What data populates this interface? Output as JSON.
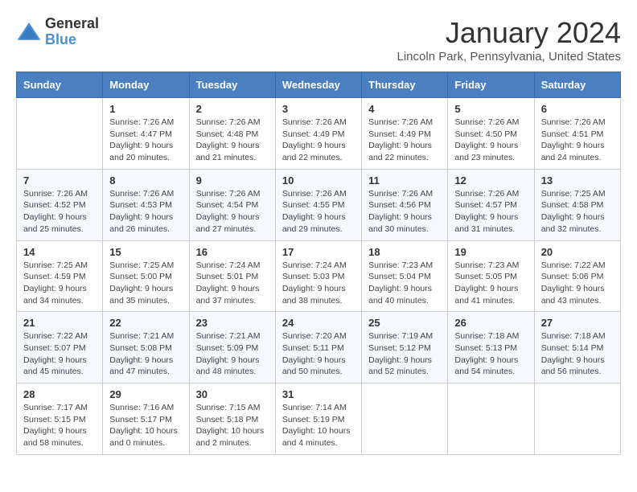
{
  "logo": {
    "general": "General",
    "blue": "Blue"
  },
  "title": "January 2024",
  "location": "Lincoln Park, Pennsylvania, United States",
  "weekdays": [
    "Sunday",
    "Monday",
    "Tuesday",
    "Wednesday",
    "Thursday",
    "Friday",
    "Saturday"
  ],
  "weeks": [
    [
      {
        "day": "",
        "content": ""
      },
      {
        "day": "1",
        "content": "Sunrise: 7:26 AM\nSunset: 4:47 PM\nDaylight: 9 hours\nand 20 minutes."
      },
      {
        "day": "2",
        "content": "Sunrise: 7:26 AM\nSunset: 4:48 PM\nDaylight: 9 hours\nand 21 minutes."
      },
      {
        "day": "3",
        "content": "Sunrise: 7:26 AM\nSunset: 4:49 PM\nDaylight: 9 hours\nand 22 minutes."
      },
      {
        "day": "4",
        "content": "Sunrise: 7:26 AM\nSunset: 4:49 PM\nDaylight: 9 hours\nand 22 minutes."
      },
      {
        "day": "5",
        "content": "Sunrise: 7:26 AM\nSunset: 4:50 PM\nDaylight: 9 hours\nand 23 minutes."
      },
      {
        "day": "6",
        "content": "Sunrise: 7:26 AM\nSunset: 4:51 PM\nDaylight: 9 hours\nand 24 minutes."
      }
    ],
    [
      {
        "day": "7",
        "content": "Sunrise: 7:26 AM\nSunset: 4:52 PM\nDaylight: 9 hours\nand 25 minutes."
      },
      {
        "day": "8",
        "content": "Sunrise: 7:26 AM\nSunset: 4:53 PM\nDaylight: 9 hours\nand 26 minutes."
      },
      {
        "day": "9",
        "content": "Sunrise: 7:26 AM\nSunset: 4:54 PM\nDaylight: 9 hours\nand 27 minutes."
      },
      {
        "day": "10",
        "content": "Sunrise: 7:26 AM\nSunset: 4:55 PM\nDaylight: 9 hours\nand 29 minutes."
      },
      {
        "day": "11",
        "content": "Sunrise: 7:26 AM\nSunset: 4:56 PM\nDaylight: 9 hours\nand 30 minutes."
      },
      {
        "day": "12",
        "content": "Sunrise: 7:26 AM\nSunset: 4:57 PM\nDaylight: 9 hours\nand 31 minutes."
      },
      {
        "day": "13",
        "content": "Sunrise: 7:25 AM\nSunset: 4:58 PM\nDaylight: 9 hours\nand 32 minutes."
      }
    ],
    [
      {
        "day": "14",
        "content": "Sunrise: 7:25 AM\nSunset: 4:59 PM\nDaylight: 9 hours\nand 34 minutes."
      },
      {
        "day": "15",
        "content": "Sunrise: 7:25 AM\nSunset: 5:00 PM\nDaylight: 9 hours\nand 35 minutes."
      },
      {
        "day": "16",
        "content": "Sunrise: 7:24 AM\nSunset: 5:01 PM\nDaylight: 9 hours\nand 37 minutes."
      },
      {
        "day": "17",
        "content": "Sunrise: 7:24 AM\nSunset: 5:03 PM\nDaylight: 9 hours\nand 38 minutes."
      },
      {
        "day": "18",
        "content": "Sunrise: 7:23 AM\nSunset: 5:04 PM\nDaylight: 9 hours\nand 40 minutes."
      },
      {
        "day": "19",
        "content": "Sunrise: 7:23 AM\nSunset: 5:05 PM\nDaylight: 9 hours\nand 41 minutes."
      },
      {
        "day": "20",
        "content": "Sunrise: 7:22 AM\nSunset: 5:06 PM\nDaylight: 9 hours\nand 43 minutes."
      }
    ],
    [
      {
        "day": "21",
        "content": "Sunrise: 7:22 AM\nSunset: 5:07 PM\nDaylight: 9 hours\nand 45 minutes."
      },
      {
        "day": "22",
        "content": "Sunrise: 7:21 AM\nSunset: 5:08 PM\nDaylight: 9 hours\nand 47 minutes."
      },
      {
        "day": "23",
        "content": "Sunrise: 7:21 AM\nSunset: 5:09 PM\nDaylight: 9 hours\nand 48 minutes."
      },
      {
        "day": "24",
        "content": "Sunrise: 7:20 AM\nSunset: 5:11 PM\nDaylight: 9 hours\nand 50 minutes."
      },
      {
        "day": "25",
        "content": "Sunrise: 7:19 AM\nSunset: 5:12 PM\nDaylight: 9 hours\nand 52 minutes."
      },
      {
        "day": "26",
        "content": "Sunrise: 7:18 AM\nSunset: 5:13 PM\nDaylight: 9 hours\nand 54 minutes."
      },
      {
        "day": "27",
        "content": "Sunrise: 7:18 AM\nSunset: 5:14 PM\nDaylight: 9 hours\nand 56 minutes."
      }
    ],
    [
      {
        "day": "28",
        "content": "Sunrise: 7:17 AM\nSunset: 5:15 PM\nDaylight: 9 hours\nand 58 minutes."
      },
      {
        "day": "29",
        "content": "Sunrise: 7:16 AM\nSunset: 5:17 PM\nDaylight: 10 hours\nand 0 minutes."
      },
      {
        "day": "30",
        "content": "Sunrise: 7:15 AM\nSunset: 5:18 PM\nDaylight: 10 hours\nand 2 minutes."
      },
      {
        "day": "31",
        "content": "Sunrise: 7:14 AM\nSunset: 5:19 PM\nDaylight: 10 hours\nand 4 minutes."
      },
      {
        "day": "",
        "content": ""
      },
      {
        "day": "",
        "content": ""
      },
      {
        "day": "",
        "content": ""
      }
    ]
  ]
}
